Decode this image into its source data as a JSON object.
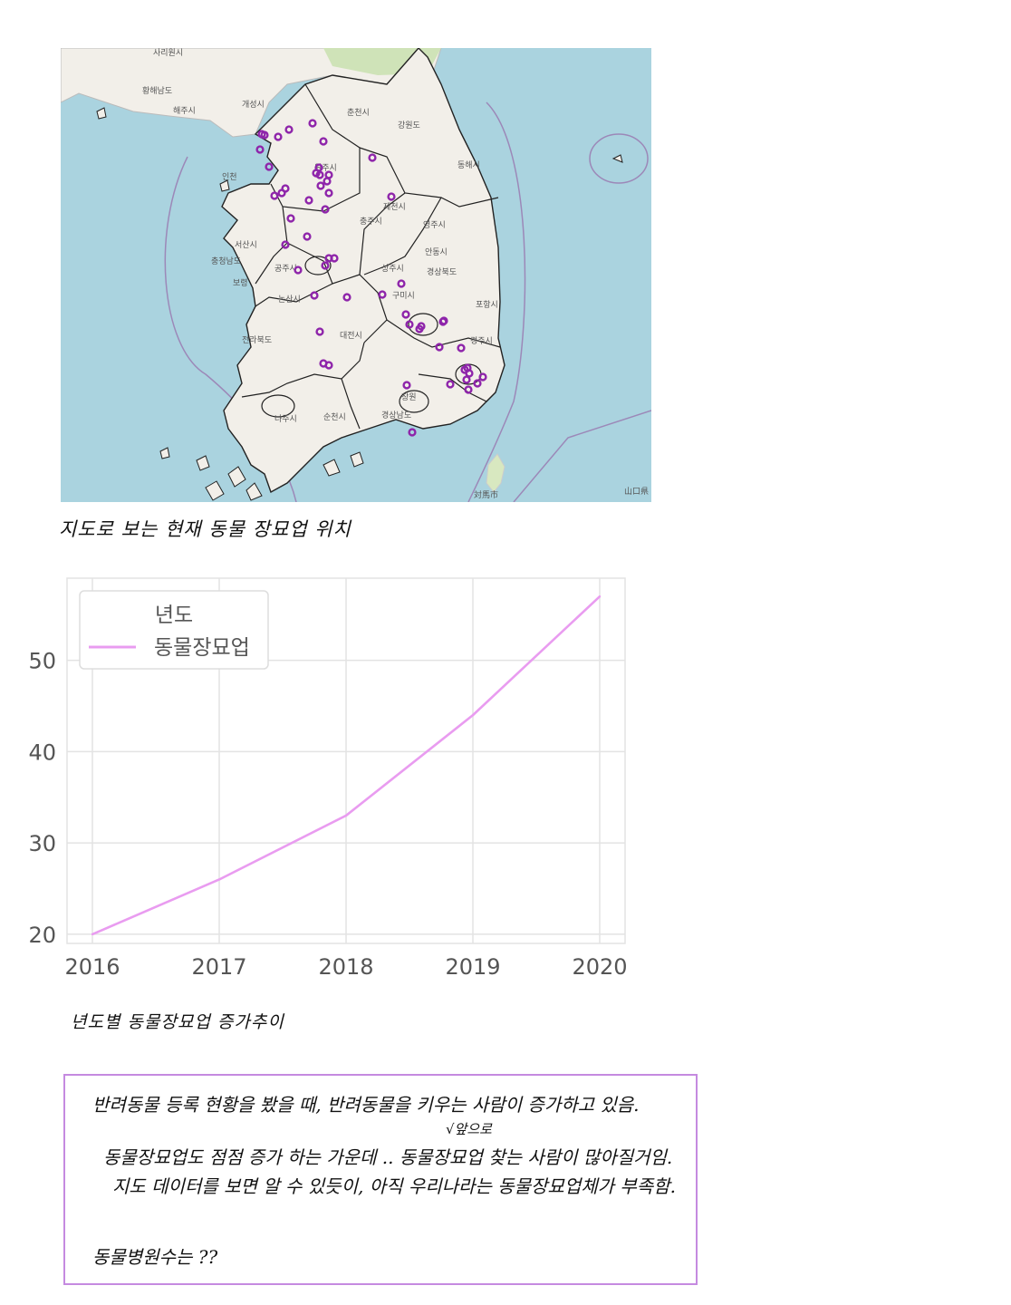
{
  "map": {
    "place_labels": [
      "사리원시",
      "황해남도",
      "해주시",
      "개성시",
      "인천",
      "춘천시",
      "강원도",
      "동해시",
      "원주시",
      "제천시",
      "충주시",
      "영주시",
      "안동시",
      "경상북도",
      "서산시",
      "충청남도",
      "보령",
      "공주시",
      "상주시",
      "구미시",
      "논산시",
      "포항시",
      "전라북도",
      "대전시",
      "경주시",
      "창원",
      "경상남도",
      "나주시",
      "순천시",
      "対馬市",
      "山口県"
    ],
    "marker_color": "#8e24aa"
  },
  "map_caption": "지도로 보는 현재 동물 장묘업 위치",
  "chart_data": {
    "type": "line",
    "x": [
      2016,
      2017,
      2018,
      2019,
      2020
    ],
    "series": [
      {
        "name": "동물장묘업",
        "values": [
          20,
          26,
          33,
          44,
          57
        ],
        "color": "#e99cf0"
      }
    ],
    "legend_title": "년도",
    "legend_position": "top-left",
    "ylim": [
      19,
      59
    ],
    "xlim": [
      2015.8,
      2020.2
    ],
    "yticks": [
      20,
      30,
      40,
      50
    ],
    "xticks": [
      2016,
      2017,
      2018,
      2019,
      2020
    ],
    "grid": true
  },
  "chart_caption": "년도별 동물장묘업 증가추이",
  "notes": {
    "line1": "반려동물 등록 현황을 봤을 때, 반려동물을 키우는 사람이 증가하고 있음.",
    "line2": "동물장묘업도 점점 증가 하는 가운데 .. 동물장묘업 찾는 사람이 많아질거임.",
    "line2_insert": "√앞으로",
    "line3": "지도 데이터를 보면 알 수 있듯이, 아직 우리나라는 동물장묘업체가 부족함.",
    "line4": "동물병원수는 ??"
  }
}
